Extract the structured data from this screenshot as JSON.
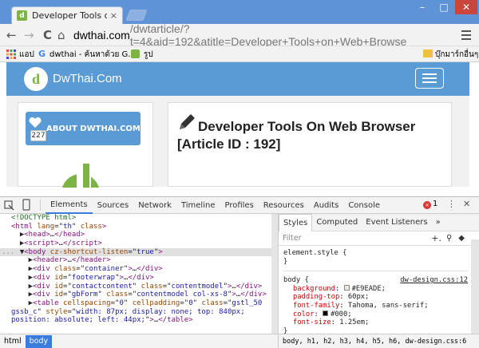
{
  "browser": {
    "tab_title": "Developer Tools on Web B",
    "tab_close": "×",
    "window_controls": [
      "–",
      "□",
      "✕"
    ],
    "nav": {
      "back": "←",
      "forward": "→",
      "reload": "C",
      "home": "⌂"
    },
    "url": {
      "host": "dwthai.com",
      "rest": "/dwtarticle/?t=4&aid=192&atitle=Developer+Tools+on+Web+Browse"
    },
    "bookmarks": [
      {
        "icon": "apps-icon",
        "label": "แอป"
      },
      {
        "icon": "google-icon",
        "label": "dwthai - ค้นหาด้วย G..."
      },
      {
        "icon": "image-icon",
        "label": "รูป"
      }
    ],
    "other_bookmarks": "บุ๊กมาร์กอื่นๆ"
  },
  "site": {
    "brand": "DwThai.Com",
    "logo_letter": "d",
    "about_label": "ABOUT DWTHAI.COM",
    "about_count": "227",
    "article_title": "Developer Tools On Web Browser [Article ID : 192]"
  },
  "devtools": {
    "tabs": [
      "Elements",
      "Sources",
      "Network",
      "Timeline",
      "Profiles",
      "Resources",
      "Audits",
      "Console"
    ],
    "active_tab": "Elements",
    "error_count": "1",
    "dom_lines": [
      {
        "html": "<span class='cm'>&lt;!DOCTYPE html&gt;</span>"
      },
      {
        "html": "<span class='tg'>&lt;html</span> <span class='an'>lang</span>=\"<span class='av'>th</span>\" <span class='an'>class</span><span class='tg'>&gt;</span>"
      },
      {
        "html": "&nbsp;&nbsp;▶<span class='tg'>&lt;head&gt;</span>…<span class='tg'>&lt;/head&gt;</span>"
      },
      {
        "html": "&nbsp;&nbsp;▶<span class='tg'>&lt;script&gt;</span>…<span class='tg'>&lt;/script&gt;</span>"
      },
      {
        "html": "&nbsp;&nbsp;▼<span class='tg'>&lt;body</span> <span class='an'>cz-shortcut-listen</span>=\"<span class='av'>true</span>\"<span class='tg'>&gt;</span>",
        "selected": true
      },
      {
        "html": "&nbsp;&nbsp;&nbsp;&nbsp;▶<span class='tg'>&lt;header&gt;</span>…<span class='tg'>&lt;/header&gt;</span>"
      },
      {
        "html": "&nbsp;&nbsp;&nbsp;&nbsp;▶<span class='tg'>&lt;div</span> <span class='an'>class</span>=\"<span class='av'>container</span>\"<span class='tg'>&gt;</span>…<span class='tg'>&lt;/div&gt;</span>"
      },
      {
        "html": "&nbsp;&nbsp;&nbsp;&nbsp;▶<span class='tg'>&lt;div</span> <span class='an'>id</span>=\"<span class='av'>footerwrap</span>\"<span class='tg'>&gt;</span>…<span class='tg'>&lt;/div&gt;</span>"
      },
      {
        "html": "&nbsp;&nbsp;&nbsp;&nbsp;▶<span class='tg'>&lt;div</span> <span class='an'>id</span>=\"<span class='av'>contactcontent</span>\" <span class='an'>class</span>=\"<span class='av'>contentmodel</span>\"<span class='tg'>&gt;</span>…<span class='tg'>&lt;/div&gt;</span>"
      },
      {
        "html": "&nbsp;&nbsp;&nbsp;&nbsp;▶<span class='tg'>&lt;div</span> <span class='an'>id</span>=\"<span class='av'>gbForm</span>\" <span class='an'>class</span>=\"<span class='av'>contentmodel col-xs-8</span>\"<span class='tg'>&gt;</span>…<span class='tg'>&lt;/div&gt;</span>"
      },
      {
        "html": "&nbsp;&nbsp;&nbsp;&nbsp;▶<span class='tg'>&lt;table</span> <span class='an'>cellspacing</span>=\"<span class='av'>0</span>\" <span class='an'>cellpadding</span>=\"<span class='av'>0</span>\" <span class='an'>class</span>=\"<span class='av'>gstl_50</span>"
      },
      {
        "html": "<span class='av'>gssb_c</span>\" <span class='an'>style</span>=\"<span class='av'>width: 87px; display: none; top: 840px;</span>"
      },
      {
        "html": "<span class='av'>position: absolute; left: 44px;</span>\"<span class='tg'>&gt;</span>…<span class='tg'>&lt;/table&gt;</span>"
      }
    ],
    "right_tabs": [
      "Styles",
      "Computed",
      "Event Listeners",
      "»"
    ],
    "filter_placeholder": "Filter",
    "styles": {
      "element_style": "element.style {",
      "close": "}",
      "selector": "body {",
      "source": "dw-design.css:12",
      "props": [
        {
          "name": "background",
          "value": "#E9EADE;",
          "swatch": "#E9EADE"
        },
        {
          "name": "padding-top",
          "value": "60px;"
        },
        {
          "name": "font-family",
          "value": "Tahoma, sans-serif;"
        },
        {
          "name": "color",
          "value": "#000;",
          "swatch": "#000000"
        },
        {
          "name": "font-size",
          "value": "1.25em;"
        }
      ]
    },
    "breadcrumbs": [
      "html",
      "body"
    ],
    "selector_crumbs": "body, h1, h2, h3, h4, h5, h6, dw-design.css:6"
  }
}
